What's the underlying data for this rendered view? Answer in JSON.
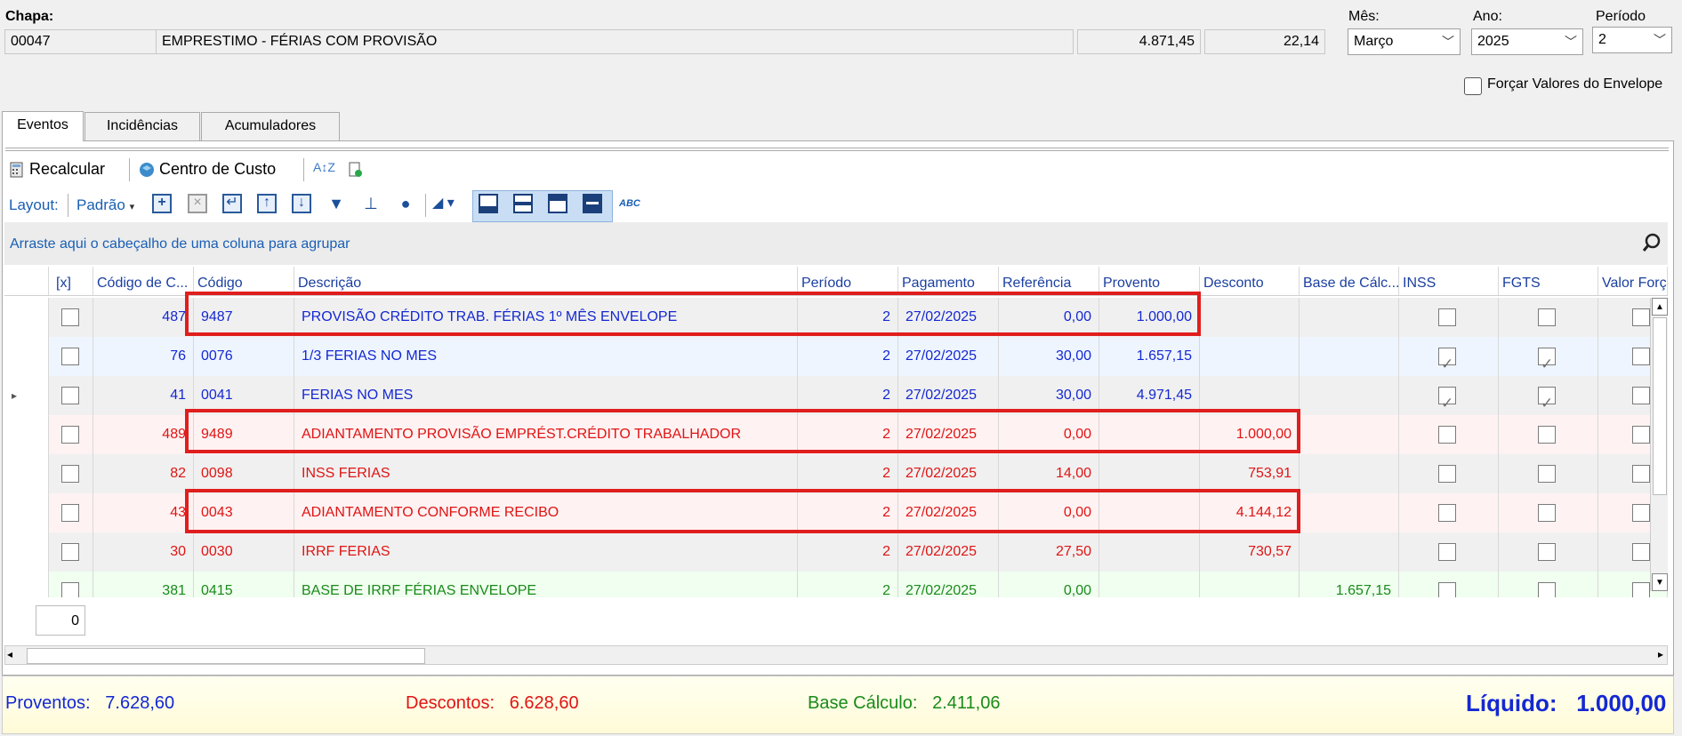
{
  "header": {
    "chapa_label": "Chapa:",
    "chapa_value": "00047",
    "descricao_value": "EMPRESTIMO - FÉRIAS COM PROVISÃO",
    "valor1": "4.871,45",
    "valor2": "22,14",
    "mes_label": "Mês:",
    "mes_value": "Março",
    "ano_label": "Ano:",
    "ano_value": "2025",
    "periodo_label": "Período",
    "periodo_value": "2",
    "forcar_label": "Forçar Valores do Envelope"
  },
  "tabs": [
    {
      "label": "Eventos",
      "active": true
    },
    {
      "label": "Incidências",
      "active": false
    },
    {
      "label": "Acumuladores",
      "active": false
    }
  ],
  "toolbar": {
    "recalcular": "Recalcular",
    "centro_custo": "Centro de Custo",
    "layout_label": "Layout:",
    "layout_value": "Padrão",
    "abc_label": "ABC"
  },
  "group_panel": "Arraste aqui o cabeçalho de uma coluna para agrupar",
  "columns": [
    "[x]",
    "Código de C...",
    "Código",
    "Descrição",
    "Período",
    "Pagamento",
    "Referência",
    "Provento",
    "Desconto",
    "Base de Cálc...",
    "INSS",
    "FGTS",
    "Valor Forç..."
  ],
  "rows": [
    {
      "codc": "487",
      "cod": "9487",
      "desc": "PROVISÃO CRÉDITO TRAB. FÉRIAS 1º MÊS ENVELOPE",
      "per": "2",
      "pag": "27/02/2025",
      "ref": "0,00",
      "prov": "1.000,00",
      "desc_v": "",
      "base": "",
      "inss": false,
      "fgts": false,
      "color": "#1428d2",
      "bg": "#f0f0f0"
    },
    {
      "codc": "76",
      "cod": "0076",
      "desc": "1/3 FERIAS NO MES",
      "per": "2",
      "pag": "27/02/2025",
      "ref": "30,00",
      "prov": "1.657,15",
      "desc_v": "",
      "base": "",
      "inss": true,
      "fgts": true,
      "color": "#1428d2",
      "bg": "#eef5ff"
    },
    {
      "codc": "41",
      "cod": "0041",
      "desc": "FERIAS NO MES",
      "per": "2",
      "pag": "27/02/2025",
      "ref": "30,00",
      "prov": "4.971,45",
      "desc_v": "",
      "base": "",
      "inss": true,
      "fgts": true,
      "color": "#1428d2",
      "bg": "#f0f0f0"
    },
    {
      "codc": "489",
      "cod": "9489",
      "desc": "ADIANTAMENTO PROVISÃO EMPRÉST.CRÉDITO TRABALHADOR",
      "per": "2",
      "pag": "27/02/2025",
      "ref": "0,00",
      "prov": "",
      "desc_v": "1.000,00",
      "base": "",
      "inss": false,
      "fgts": false,
      "color": "#e01414",
      "bg": "#fff2f2"
    },
    {
      "codc": "82",
      "cod": "0098",
      "desc": "INSS FERIAS",
      "per": "2",
      "pag": "27/02/2025",
      "ref": "14,00",
      "prov": "",
      "desc_v": "753,91",
      "base": "",
      "inss": false,
      "fgts": false,
      "color": "#e01414",
      "bg": "#f0f0f0"
    },
    {
      "codc": "43",
      "cod": "0043",
      "desc": "ADIANTAMENTO CONFORME RECIBO",
      "per": "2",
      "pag": "27/02/2025",
      "ref": "0,00",
      "prov": "",
      "desc_v": "4.144,12",
      "base": "",
      "inss": false,
      "fgts": false,
      "color": "#e01414",
      "bg": "#fff2f2"
    },
    {
      "codc": "30",
      "cod": "0030",
      "desc": "IRRF FERIAS",
      "per": "2",
      "pag": "27/02/2025",
      "ref": "27,50",
      "prov": "",
      "desc_v": "730,57",
      "base": "",
      "inss": false,
      "fgts": false,
      "color": "#e01414",
      "bg": "#f0f0f0"
    },
    {
      "codc": "381",
      "cod": "0415",
      "desc": "BASE DE IRRF FÉRIAS ENVELOPE",
      "per": "2",
      "pag": "27/02/2025",
      "ref": "0,00",
      "prov": "",
      "desc_v": "",
      "base": "1.657,15",
      "inss": false,
      "fgts": false,
      "color": "#1a8a1a",
      "bg": "#f0fff0"
    }
  ],
  "footer_count": "0",
  "totals": {
    "proventos_label": "Proventos:",
    "proventos_value": "7.628,60",
    "descontos_label": "Descontos:",
    "descontos_value": "6.628,60",
    "base_label": "Base Cálculo:",
    "base_value": "2.411,06",
    "liquido_label": "Líquido:",
    "liquido_value": "1.000,00"
  }
}
